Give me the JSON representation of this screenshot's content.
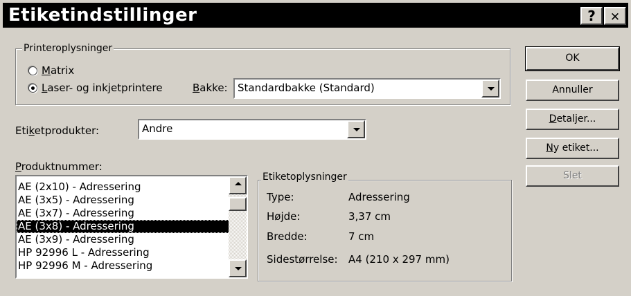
{
  "window": {
    "title": "Etiketindstillinger",
    "help_glyph": "?",
    "close_glyph": "✕"
  },
  "printer_group": {
    "legend": "Printeroplysninger",
    "radio_matrix": {
      "pre": "",
      "key": "M",
      "post": "atrix",
      "checked": false
    },
    "radio_laser": {
      "pre": "",
      "key": "L",
      "post": "aser- og inkjetprintere",
      "checked": true
    },
    "tray_label": {
      "pre": "",
      "key": "B",
      "post": "akke:"
    },
    "tray_value": "Standardbakke (Standard)"
  },
  "label_products": {
    "label": {
      "pre": "Eti",
      "key": "k",
      "post": "etprodukter:"
    },
    "value": "Andre"
  },
  "product_numbers": {
    "label": {
      "pre": "",
      "key": "P",
      "post": "roduktnummer:"
    },
    "items": [
      "AE (2x10) - Adressering",
      "AE (3x5) - Adressering",
      "AE (3x7) - Adressering",
      "AE (3x8) - Adressering",
      "AE (3x9) - Adressering",
      "HP 92996 L - Adressering",
      "HP 92996 M - Adressering"
    ],
    "selected_index": 3
  },
  "label_info": {
    "legend": "Etiketoplysninger",
    "rows": [
      {
        "key": "Type:",
        "value": "Adressering"
      },
      {
        "key": "Højde:",
        "value": "3,37 cm"
      },
      {
        "key": "Bredde:",
        "value": "7 cm"
      },
      {
        "key": "Sidestørrelse:",
        "value": "A4 (210 x 297 mm)"
      }
    ]
  },
  "buttons": {
    "ok": {
      "pre": "OK",
      "key": "",
      "post": ""
    },
    "cancel": {
      "pre": "Annuller",
      "key": "",
      "post": ""
    },
    "details": {
      "pre": "",
      "key": "D",
      "post": "etaljer..."
    },
    "new_label": {
      "pre": "",
      "key": "N",
      "post": "y etiket..."
    },
    "delete": {
      "pre": "Slet",
      "key": "",
      "post": ""
    }
  },
  "colors": {
    "titlebar": "#000000",
    "face": "#d4d0c8",
    "selection": "#000000"
  }
}
